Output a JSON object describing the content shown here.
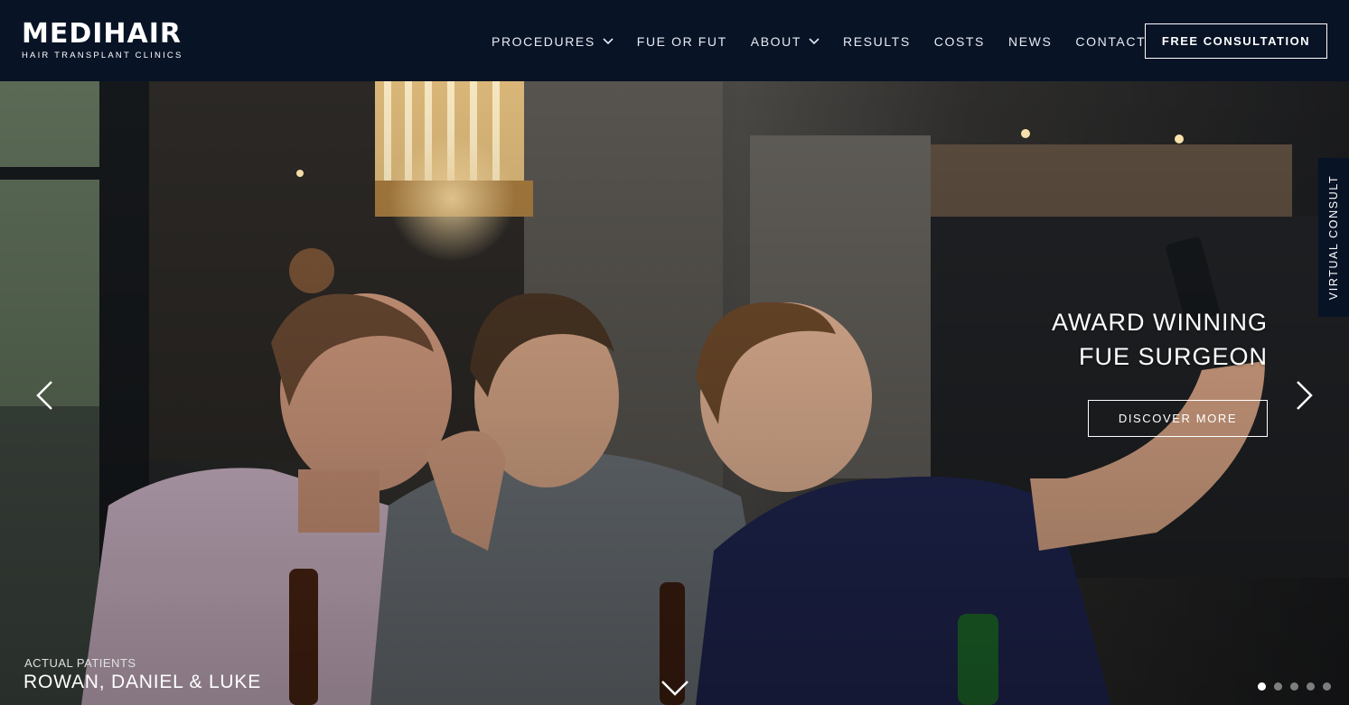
{
  "brand": {
    "name": "MEDIHAIR",
    "tagline": "HAIR TRANSPLANT CLINICS"
  },
  "nav": {
    "items": [
      {
        "label": "PROCEDURES",
        "has_dropdown": true
      },
      {
        "label": "FUE OR FUT",
        "has_dropdown": false
      },
      {
        "label": "ABOUT",
        "has_dropdown": true
      },
      {
        "label": "RESULTS",
        "has_dropdown": false
      },
      {
        "label": "COSTS",
        "has_dropdown": false
      },
      {
        "label": "NEWS",
        "has_dropdown": false
      },
      {
        "label": "CONTACT",
        "has_dropdown": false
      }
    ],
    "cta_label": "FREE CONSULTATION"
  },
  "hero": {
    "headline_line1": "AWARD WINNING",
    "headline_line2": "FUE SURGEON",
    "button_label": "DISCOVER MORE",
    "caption_small": "ACTUAL PATIENTS",
    "caption_big": "ROWAN, DANIEL & LUKE",
    "side_tab": "VIRTUAL CONSULT",
    "slides_total": 5,
    "active_slide": 1
  },
  "icons": {
    "prev": "chevron-left-icon",
    "next": "chevron-right-icon",
    "scroll": "chevron-down-icon",
    "dropdown": "chevron-down-icon"
  },
  "colors": {
    "header_bg": "#081326",
    "text": "#ffffff"
  }
}
